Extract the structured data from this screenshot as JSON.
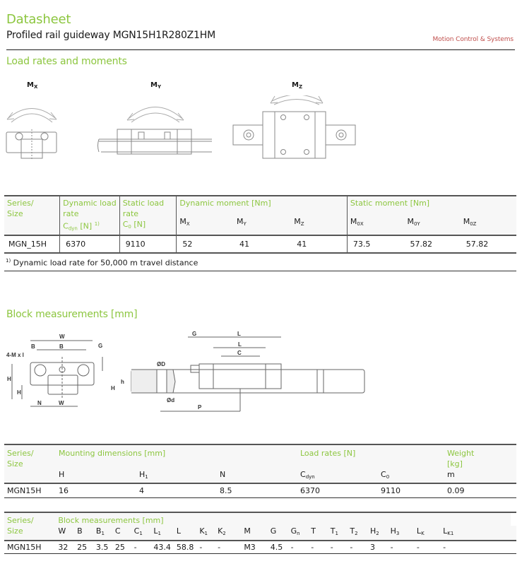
{
  "header": {
    "title": "Datasheet",
    "subtitle": "Profiled rail guideway MGN15H1R280Z1HM",
    "brand": "Motion Control & Systems"
  },
  "sections": {
    "load_rates": "Load rates and moments",
    "block_measurements": "Block measurements [mm]"
  },
  "moment_diagrams": [
    {
      "label": "M",
      "sub": "X",
      "icon": "rail-block-end-view-drawing"
    },
    {
      "label": "M",
      "sub": "Y",
      "icon": "rail-block-side-view-drawing"
    },
    {
      "label": "M",
      "sub": "Z",
      "icon": "rail-block-top-view-drawing"
    }
  ],
  "load_table": {
    "series_header": [
      "Series/",
      "Size"
    ],
    "dyn_load_header": [
      "Dynamic load",
      "rate"
    ],
    "dyn_load_symbol": {
      "base": "C",
      "sub": "dyn",
      "unit": " [N] ",
      "sup": "1)"
    },
    "static_load_header": [
      "Static load",
      "rate"
    ],
    "static_load_symbol": {
      "base": "C",
      "sub": "0",
      "unit": " [N]"
    },
    "dyn_moment_header": "Dynamic moment [Nm]",
    "static_moment_header": "Static moment [Nm]",
    "moment_cols": [
      {
        "base": "M",
        "sub": "X"
      },
      {
        "base": "M",
        "sub": "Y"
      },
      {
        "base": "M",
        "sub": "Z"
      },
      {
        "base": "M",
        "sub": "0X"
      },
      {
        "base": "M",
        "sub": "0Y"
      },
      {
        "base": "M",
        "sub": "0Z"
      }
    ],
    "row": {
      "series": "MGN_15H",
      "c_dyn": "6370",
      "c_0": "9110",
      "mx": "52",
      "my": "41",
      "mz": "41",
      "m0x": "73.5",
      "m0y": "57.82",
      "m0z": "57.82"
    },
    "footnote_mark": "1)",
    "footnote": " Dynamic load rate for 50,000 m travel distance"
  },
  "drawing_labels": {
    "front": [
      "W",
      "B",
      "B1",
      "G n",
      "4-M x l",
      "H2",
      "H",
      "H1",
      "N",
      "WR"
    ],
    "side": [
      "G",
      "L",
      "L1",
      "C",
      "ØD",
      "H1",
      "h",
      "Ød",
      "P"
    ]
  },
  "mounting_table": {
    "series_header": [
      "Series/",
      "Size"
    ],
    "mount_header": "Mounting dimensions [mm]",
    "load_header": "Load rates [N]",
    "weight_header": [
      "Weight",
      "[kg]"
    ],
    "cols": [
      {
        "base": "H",
        "sub": ""
      },
      {
        "base": "H",
        "sub": "1"
      },
      {
        "base": "N",
        "sub": ""
      },
      {
        "base": "C",
        "sub": "dyn"
      },
      {
        "base": "C",
        "sub": "0"
      },
      {
        "base": "m",
        "sub": ""
      }
    ],
    "row": {
      "series": "MGN15H",
      "values": [
        "16",
        "4",
        "8.5",
        "6370",
        "9110",
        "0.09"
      ]
    }
  },
  "block_table": {
    "series_header": [
      "Series/",
      "Size"
    ],
    "block_header": "Block measurements [mm]",
    "cols": [
      {
        "base": "W",
        "sub": ""
      },
      {
        "base": "B",
        "sub": ""
      },
      {
        "base": "B",
        "sub": "1"
      },
      {
        "base": "C",
        "sub": ""
      },
      {
        "base": "C",
        "sub": "1"
      },
      {
        "base": "L",
        "sub": "1"
      },
      {
        "base": "L",
        "sub": ""
      },
      {
        "base": "K",
        "sub": "1"
      },
      {
        "base": "K",
        "sub": "2"
      },
      {
        "base": "M",
        "sub": ""
      },
      {
        "base": "G",
        "sub": ""
      },
      {
        "base": "G",
        "sub": "n"
      },
      {
        "base": "T",
        "sub": ""
      },
      {
        "base": "T",
        "sub": "1"
      },
      {
        "base": "T",
        "sub": "2"
      },
      {
        "base": "H",
        "sub": "2"
      },
      {
        "base": "H",
        "sub": "3"
      },
      {
        "base": "L",
        "sub": "K"
      },
      {
        "base": "L",
        "sub": "K1"
      }
    ],
    "row": {
      "series": "MGN15H",
      "values": [
        "32",
        "25",
        "3.5",
        "25",
        "-",
        "43.4",
        "58.8",
        "-",
        "-",
        "M3",
        "4.5",
        "-",
        "-",
        "-",
        "-",
        "3",
        "-",
        "-",
        "-"
      ]
    }
  }
}
